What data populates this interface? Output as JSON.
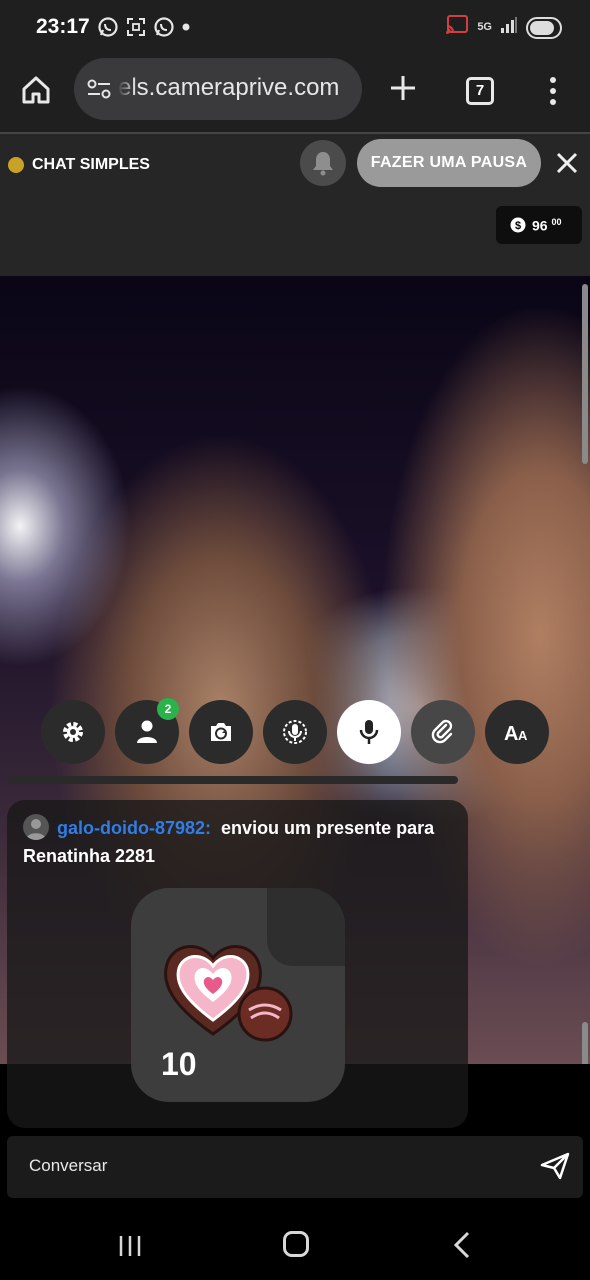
{
  "status_bar": {
    "time": "23:17",
    "network": "5G"
  },
  "browser": {
    "url": "els.cameraprive.com",
    "tab_count": "7"
  },
  "header": {
    "mode_label": "CHAT SIMPLES",
    "pause_button": "FAZER UMA PAUSA",
    "balance": "96",
    "balance_cents": "00",
    "status_dot_color": "#c8a226"
  },
  "controls": {
    "viewers_badge": "2",
    "items": [
      "gear-icon",
      "user-icon",
      "camera-switch-icon",
      "mic-off-icon",
      "mic-icon",
      "link-icon",
      "font-size-icon"
    ]
  },
  "chat": {
    "username": "galo-doido-87982:",
    "message": "enviou um presente para Renatinha 2281",
    "gift_count": "10",
    "username_color": "#2f7de6"
  },
  "input": {
    "placeholder": "Conversar"
  }
}
